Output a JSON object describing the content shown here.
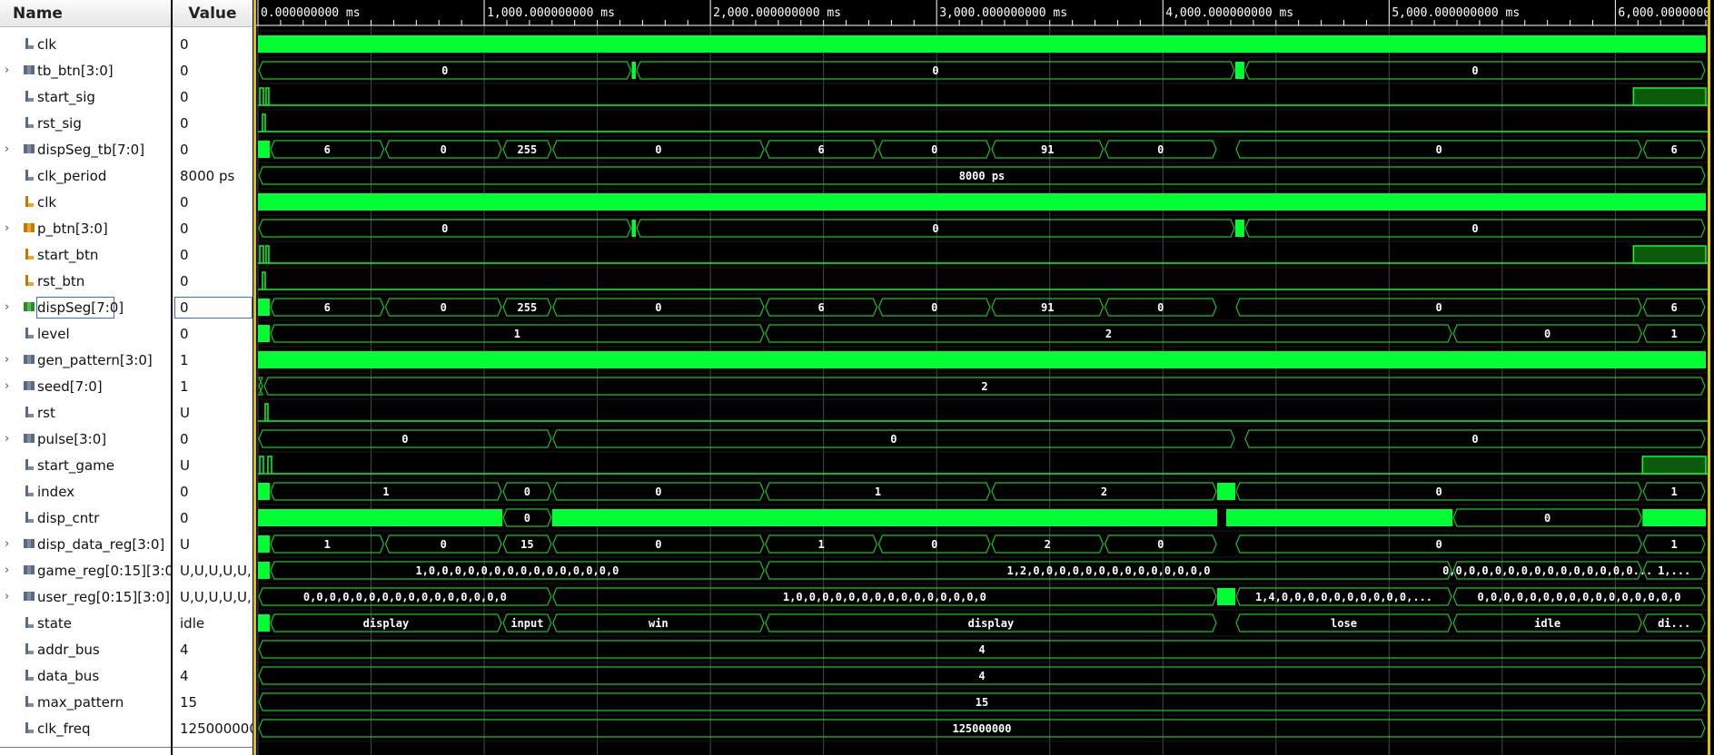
{
  "header": {
    "name_label": "Name",
    "value_label": "Value"
  },
  "time_ticks": [
    "0.000000000 ms",
    "1,000.000000000 ms",
    "2,000.000000000 ms",
    "3,000.000000000 ms",
    "4,000.000000000 ms",
    "5,000.000000000 ms",
    "6,000.000000000 ms"
  ],
  "colors": {
    "wave": "#00ff33",
    "bus_line": "#19c21f",
    "grid": "#4a4a4a",
    "background": "#000000",
    "cursor": "#d9c200"
  },
  "signals": [
    {
      "name": "clk",
      "value": "0",
      "icon": "bit-icon",
      "expand": false,
      "kind": "clock"
    },
    {
      "name": "tb_btn[3:0]",
      "value": "0",
      "icon": "bus-icon",
      "expand": true,
      "kind": "bus",
      "segs": [
        [
          0,
          4130,
          "0"
        ],
        [
          4175,
          10800,
          "0"
        ],
        [
          10900,
          16000,
          "0"
        ]
      ],
      "fill": [
        [
          4130,
          4175
        ],
        [
          10800,
          10900
        ]
      ]
    },
    {
      "name": "start_sig",
      "value": "0",
      "icon": "bit-icon",
      "expand": false,
      "kind": "bit",
      "pulses": [
        [
          20,
          60
        ],
        [
          90,
          120
        ]
      ],
      "high_tail": 15200
    },
    {
      "name": "rst_sig",
      "value": "0",
      "icon": "bit-icon",
      "expand": false,
      "kind": "bit",
      "pulses": [
        [
          50,
          80
        ]
      ]
    },
    {
      "name": "dispSeg_tb[7:0]",
      "value": "0",
      "icon": "bus-icon",
      "expand": true,
      "kind": "bus",
      "segs": [
        [
          130,
          1400,
          "6"
        ],
        [
          1400,
          2700,
          "0"
        ],
        [
          2700,
          3250,
          "255"
        ],
        [
          3250,
          5600,
          "0"
        ],
        [
          5600,
          6850,
          "6"
        ],
        [
          6850,
          8100,
          "0"
        ],
        [
          8100,
          9350,
          "91"
        ],
        [
          9350,
          10600,
          "0"
        ],
        [
          10800,
          15300,
          "0"
        ],
        [
          15300,
          16000,
          "6"
        ]
      ],
      "fill": [
        [
          0,
          130
        ]
      ]
    },
    {
      "name": "clk_period",
      "value": "8000 ps",
      "icon": "bit-icon",
      "expand": false,
      "kind": "bus",
      "segs": [
        [
          0,
          16000,
          "8000 ps"
        ]
      ]
    },
    {
      "name": "clk",
      "value": "0",
      "icon": "bit-icon-orange",
      "expand": false,
      "kind": "clock"
    },
    {
      "name": "p_btn[3:0]",
      "value": "0",
      "icon": "bus-icon-orange",
      "expand": true,
      "kind": "bus",
      "segs": [
        [
          0,
          4130,
          "0"
        ],
        [
          4175,
          10800,
          "0"
        ],
        [
          10900,
          16000,
          "0"
        ]
      ],
      "fill": [
        [
          4130,
          4175
        ],
        [
          10800,
          10900
        ]
      ]
    },
    {
      "name": "start_btn",
      "value": "0",
      "icon": "bit-icon-orange",
      "expand": false,
      "kind": "bit",
      "pulses": [
        [
          20,
          60
        ],
        [
          90,
          120
        ]
      ],
      "high_tail": 15200
    },
    {
      "name": "rst_btn",
      "value": "0",
      "icon": "bit-icon-orange",
      "expand": false,
      "kind": "bit",
      "pulses": [
        [
          50,
          80
        ]
      ]
    },
    {
      "name": "dispSeg[7:0]",
      "value": "0",
      "icon": "bus-icon-green",
      "expand": true,
      "kind": "bus",
      "selected": true,
      "segs": [
        [
          130,
          1400,
          "6"
        ],
        [
          1400,
          2700,
          "0"
        ],
        [
          2700,
          3250,
          "255"
        ],
        [
          3250,
          5600,
          "0"
        ],
        [
          5600,
          6850,
          "6"
        ],
        [
          6850,
          8100,
          "0"
        ],
        [
          8100,
          9350,
          "91"
        ],
        [
          9350,
          10600,
          "0"
        ],
        [
          10800,
          15300,
          "0"
        ],
        [
          15300,
          16000,
          "6"
        ]
      ],
      "fill": [
        [
          0,
          130
        ]
      ]
    },
    {
      "name": "level",
      "value": "0",
      "icon": "bit-icon",
      "expand": false,
      "kind": "bus",
      "segs": [
        [
          130,
          5600,
          "1"
        ],
        [
          5600,
          13200,
          "2"
        ],
        [
          13200,
          15300,
          "0"
        ],
        [
          15300,
          16000,
          "1"
        ]
      ],
      "fill": [
        [
          0,
          130
        ]
      ]
    },
    {
      "name": "gen_pattern[3:0]",
      "value": "1",
      "icon": "bus-icon",
      "expand": true,
      "kind": "solid"
    },
    {
      "name": "seed[7:0]",
      "value": "1",
      "icon": "bus-icon",
      "expand": true,
      "kind": "bus",
      "segs": [
        [
          0,
          60,
          ""
        ],
        [
          60,
          16000,
          "2"
        ]
      ]
    },
    {
      "name": "rst",
      "value": "U",
      "icon": "bit-icon",
      "expand": false,
      "kind": "bit",
      "pulses": [
        [
          80,
          110
        ]
      ]
    },
    {
      "name": "pulse[3:0]",
      "value": "0",
      "icon": "bus-icon",
      "expand": true,
      "kind": "bus",
      "segs": [
        [
          0,
          3250,
          "0"
        ],
        [
          3250,
          10800,
          "0"
        ],
        [
          10900,
          16000,
          "0"
        ]
      ],
      "fill": []
    },
    {
      "name": "start_game",
      "value": "U",
      "icon": "bit-icon",
      "expand": false,
      "kind": "bit",
      "pulses": [
        [
          20,
          60
        ],
        [
          110,
          150
        ]
      ],
      "high_tail": 15300
    },
    {
      "name": "index",
      "value": "0",
      "icon": "bit-icon",
      "expand": false,
      "kind": "bus",
      "segs": [
        [
          130,
          2700,
          "1"
        ],
        [
          2700,
          3250,
          "0"
        ],
        [
          3250,
          5600,
          "0"
        ],
        [
          5600,
          8100,
          "1"
        ],
        [
          8100,
          10600,
          "2"
        ],
        [
          10800,
          15300,
          "0"
        ],
        [
          15300,
          16000,
          "1"
        ]
      ],
      "fill": [
        [
          0,
          130
        ],
        [
          10600,
          10800
        ]
      ]
    },
    {
      "name": "disp_cntr",
      "value": "0",
      "icon": "bit-icon",
      "expand": false,
      "kind": "bus",
      "segs": [
        [
          2700,
          3250,
          "0"
        ],
        [
          13200,
          15300,
          "0"
        ]
      ],
      "fill": [
        [
          0,
          2700
        ],
        [
          3250,
          10600
        ],
        [
          10700,
          13200
        ],
        [
          15300,
          16000
        ]
      ]
    },
    {
      "name": "disp_data_reg[3:0]",
      "value": "U",
      "icon": "bus-icon",
      "expand": true,
      "kind": "bus",
      "segs": [
        [
          130,
          1400,
          "1"
        ],
        [
          1400,
          2700,
          "0"
        ],
        [
          2700,
          3250,
          "15"
        ],
        [
          3250,
          5600,
          "0"
        ],
        [
          5600,
          6850,
          "1"
        ],
        [
          6850,
          8100,
          "0"
        ],
        [
          8100,
          9350,
          "2"
        ],
        [
          9350,
          10600,
          "0"
        ],
        [
          10800,
          15300,
          "0"
        ],
        [
          15300,
          16000,
          "1"
        ]
      ],
      "fill": [
        [
          0,
          130
        ]
      ]
    },
    {
      "name": "game_reg[0:15][3:0]",
      "value": "U,U,U,U,U,U,",
      "icon": "bus-icon",
      "expand": true,
      "kind": "bus",
      "segs": [
        [
          130,
          5600,
          "1,0,0,0,0,0,0,0,0,0,0,0,0,0,0,0"
        ],
        [
          5600,
          13200,
          "1,2,0,0,0,0,0,0,0,0,0,0,0,0,0,0"
        ],
        [
          13200,
          15300,
          "0,0,0,0,0,0,0,0,0,0,0,0,0,0,0..."
        ],
        [
          15300,
          16000,
          "1,..."
        ]
      ],
      "fill": [
        [
          0,
          130
        ]
      ]
    },
    {
      "name": "user_reg[0:15][3:0]",
      "value": "U,U,U,U,U,U,",
      "icon": "bus-icon",
      "expand": true,
      "kind": "bus",
      "segs": [
        [
          0,
          3250,
          "0,0,0,0,0,0,0,0,0,0,0,0,0,0,0,0"
        ],
        [
          3250,
          10600,
          "1,0,0,0,0,0,0,0,0,0,0,0,0,0,0,0"
        ],
        [
          10800,
          13200,
          "1,4,0,0,0,0,0,0,0,0,0,0,..."
        ],
        [
          13200,
          16000,
          "0,0,0,0,0,0,0,0,0,0,0,0,0,0,0,0"
        ]
      ],
      "fill": [
        [
          10600,
          10800
        ]
      ]
    },
    {
      "name": "state",
      "value": "idle",
      "icon": "bit-icon",
      "expand": false,
      "kind": "bus",
      "segs": [
        [
          130,
          2700,
          "display"
        ],
        [
          2700,
          3250,
          "input"
        ],
        [
          3250,
          5600,
          "win"
        ],
        [
          5600,
          10600,
          "display"
        ],
        [
          10800,
          13200,
          "lose"
        ],
        [
          13200,
          15300,
          "idle"
        ],
        [
          15300,
          16000,
          "di..."
        ]
      ],
      "fill": [
        [
          0,
          130
        ]
      ]
    },
    {
      "name": "addr_bus",
      "value": "4",
      "icon": "bit-icon",
      "expand": false,
      "kind": "bus",
      "segs": [
        [
          0,
          16000,
          "4"
        ]
      ]
    },
    {
      "name": "data_bus",
      "value": "4",
      "icon": "bit-icon",
      "expand": false,
      "kind": "bus",
      "segs": [
        [
          0,
          16000,
          "4"
        ]
      ]
    },
    {
      "name": "max_pattern",
      "value": "15",
      "icon": "bit-icon",
      "expand": false,
      "kind": "bus",
      "segs": [
        [
          0,
          16000,
          "15"
        ]
      ]
    },
    {
      "name": "clk_freq",
      "value": "125000000",
      "icon": "bit-icon",
      "expand": false,
      "kind": "bus",
      "segs": [
        [
          0,
          16000,
          "125000000"
        ]
      ]
    }
  ]
}
